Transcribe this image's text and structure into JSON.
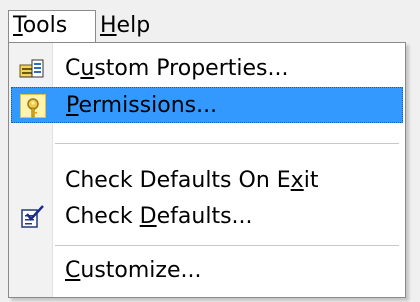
{
  "menubar": {
    "tools": {
      "label": "Tools",
      "mnemonic": "T",
      "rest": "ools"
    },
    "help": {
      "label": "Help",
      "mnemonic": "H",
      "rest": "elp"
    }
  },
  "menu": {
    "items": [
      {
        "label": "Custom Properties...",
        "pre": "C",
        "mn": "u",
        "post": "stom Properties...",
        "icon": "properties-icon"
      },
      {
        "label": "Permissions...",
        "pre": "",
        "mn": "P",
        "post": "ermissions...",
        "icon": "key-icon",
        "highlighted": true
      },
      {
        "label": "Check Defaults On Exit",
        "pre": "Check Defaults On E",
        "mn": "x",
        "post": "it",
        "icon": ""
      },
      {
        "label": "Check Defaults...",
        "pre": "Check ",
        "mn": "D",
        "post": "efaults...",
        "icon": "check-document-icon"
      },
      {
        "label": "Customize...",
        "pre": "",
        "mn": "C",
        "post": "ustomize...",
        "icon": ""
      }
    ]
  },
  "colors": {
    "highlight": "#3399ff",
    "menu_background": "#ffffff",
    "menubar_background": "#f0f0f0"
  }
}
